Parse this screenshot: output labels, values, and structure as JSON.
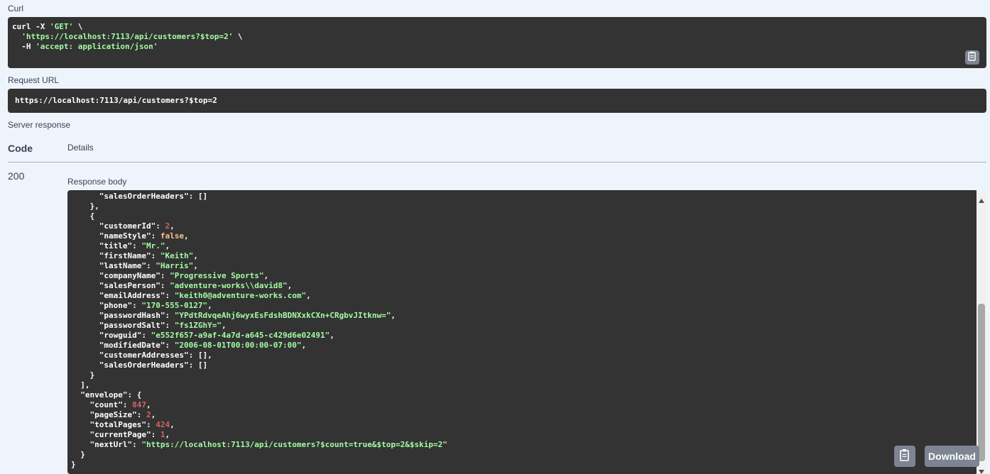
{
  "curl": {
    "label": "Curl",
    "line1_cmd": "curl -X ",
    "line1_method": "'GET'",
    "line1_tail": " \\",
    "line2_url": "'https://localhost:7113/api/customers?$top=2'",
    "line2_tail": " \\",
    "line3_flag": "  -H ",
    "line3_header": "'accept: application/json'"
  },
  "request_url": {
    "label": "Request URL",
    "value": "https://localhost:7113/api/customers?$top=2"
  },
  "server_response": {
    "label": "Server response",
    "col_code": "Code",
    "col_details": "Details",
    "code": "200",
    "body_label": "Response body",
    "download_label": "Download"
  },
  "response_lines": [
    [
      [
        "      ",
        ""
      ],
      [
        "\"salesOrderHeaders\"",
        ""
      ],
      [
        ": []",
        ""
      ]
    ],
    [
      [
        "    },",
        ""
      ]
    ],
    [
      [
        "    {",
        ""
      ]
    ],
    [
      [
        "      \"customerId\"",
        ""
      ],
      [
        ": ",
        ""
      ],
      [
        "2",
        "n"
      ],
      [
        ",",
        ""
      ]
    ],
    [
      [
        "      \"nameStyle\"",
        ""
      ],
      [
        ": ",
        ""
      ],
      [
        "false",
        "k"
      ],
      [
        ",",
        ""
      ]
    ],
    [
      [
        "      \"title\"",
        ""
      ],
      [
        ": ",
        ""
      ],
      [
        "\"Mr.\"",
        "s"
      ],
      [
        ",",
        ""
      ]
    ],
    [
      [
        "      \"firstName\"",
        ""
      ],
      [
        ": ",
        ""
      ],
      [
        "\"Keith\"",
        "s"
      ],
      [
        ",",
        ""
      ]
    ],
    [
      [
        "      \"lastName\"",
        ""
      ],
      [
        ": ",
        ""
      ],
      [
        "\"Harris\"",
        "s"
      ],
      [
        ",",
        ""
      ]
    ],
    [
      [
        "      \"companyName\"",
        ""
      ],
      [
        ": ",
        ""
      ],
      [
        "\"Progressive Sports\"",
        "s"
      ],
      [
        ",",
        ""
      ]
    ],
    [
      [
        "      \"salesPerson\"",
        ""
      ],
      [
        ": ",
        ""
      ],
      [
        "\"adventure-works\\\\david8\"",
        "s"
      ],
      [
        ",",
        ""
      ]
    ],
    [
      [
        "      \"emailAddress\"",
        ""
      ],
      [
        ": ",
        ""
      ],
      [
        "\"keith0@adventure-works.com\"",
        "s"
      ],
      [
        ",",
        ""
      ]
    ],
    [
      [
        "      \"phone\"",
        ""
      ],
      [
        ": ",
        ""
      ],
      [
        "\"170-555-0127\"",
        "s"
      ],
      [
        ",",
        ""
      ]
    ],
    [
      [
        "      \"passwordHash\"",
        ""
      ],
      [
        ": ",
        ""
      ],
      [
        "\"YPdtRdvqeAhj6wyxEsFdshBDNXxkCXn+CRgbvJItknw=\"",
        "s"
      ],
      [
        ",",
        ""
      ]
    ],
    [
      [
        "      \"passwordSalt\"",
        ""
      ],
      [
        ": ",
        ""
      ],
      [
        "\"fs1ZGhY=\"",
        "s"
      ],
      [
        ",",
        ""
      ]
    ],
    [
      [
        "      \"rowguid\"",
        ""
      ],
      [
        ": ",
        ""
      ],
      [
        "\"e552f657-a9af-4a7d-a645-c429d6e02491\"",
        "s"
      ],
      [
        ",",
        ""
      ]
    ],
    [
      [
        "      \"modifiedDate\"",
        ""
      ],
      [
        ": ",
        ""
      ],
      [
        "\"2006-08-01T00:00:00-07:00\"",
        "s"
      ],
      [
        ",",
        ""
      ]
    ],
    [
      [
        "      \"customerAddresses\"",
        ""
      ],
      [
        ": [],",
        ""
      ]
    ],
    [
      [
        "      \"salesOrderHeaders\"",
        ""
      ],
      [
        ": []",
        ""
      ]
    ],
    [
      [
        "    }",
        ""
      ]
    ],
    [
      [
        "  ],",
        ""
      ]
    ],
    [
      [
        "  \"envelope\"",
        ""
      ],
      [
        ": {",
        ""
      ]
    ],
    [
      [
        "    \"count\"",
        ""
      ],
      [
        ": ",
        ""
      ],
      [
        "847",
        "n"
      ],
      [
        ",",
        ""
      ]
    ],
    [
      [
        "    \"pageSize\"",
        ""
      ],
      [
        ": ",
        ""
      ],
      [
        "2",
        "n"
      ],
      [
        ",",
        ""
      ]
    ],
    [
      [
        "    \"totalPages\"",
        ""
      ],
      [
        ": ",
        ""
      ],
      [
        "424",
        "n"
      ],
      [
        ",",
        ""
      ]
    ],
    [
      [
        "    \"currentPage\"",
        ""
      ],
      [
        ": ",
        ""
      ],
      [
        "1",
        "n"
      ],
      [
        ",",
        ""
      ]
    ],
    [
      [
        "    \"nextUrl\"",
        ""
      ],
      [
        ": ",
        ""
      ],
      [
        "\"https://localhost:7113/api/customers?$count=true&$top=2&$skip=2\"",
        "s"
      ]
    ],
    [
      [
        "  }",
        ""
      ]
    ],
    [
      [
        "}",
        ""
      ]
    ]
  ],
  "icons": {
    "copy": "clipboard-icon",
    "scroll_up": "chevron-up-icon",
    "scroll_down": "chevron-down-icon"
  },
  "colors": {
    "page_bg": "#eef4fb",
    "code_bg": "#333333",
    "string": "#a2fca2",
    "number": "#d36363",
    "keyword": "#fcc28c",
    "button": "#7d8492"
  }
}
